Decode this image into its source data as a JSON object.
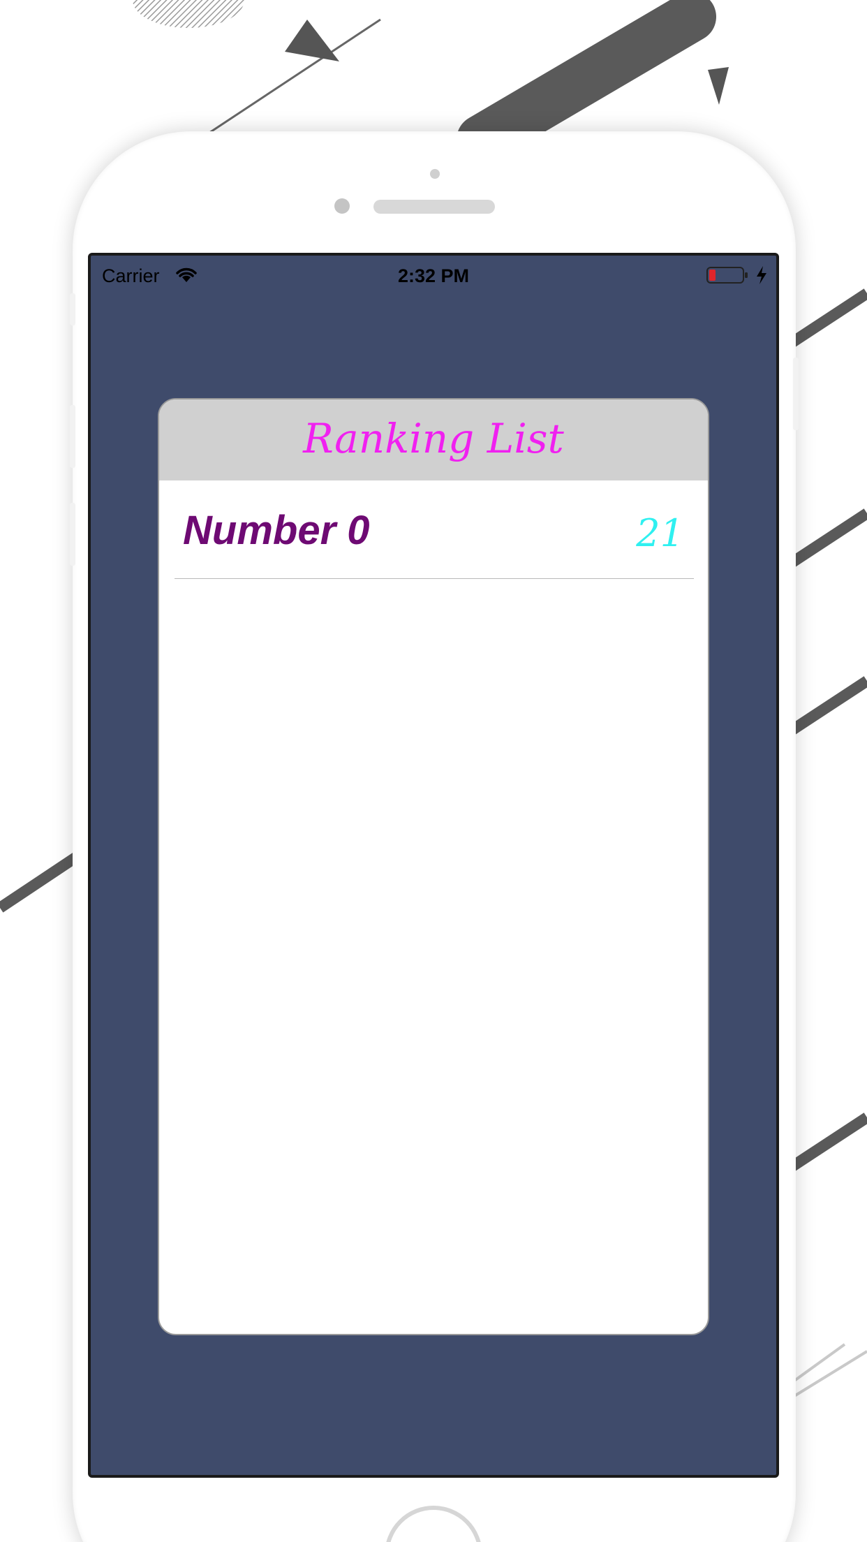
{
  "status_bar": {
    "carrier": "Carrier",
    "time": "2:32 PM",
    "icons": [
      "wifi-icon",
      "battery-icon",
      "charging-bolt-icon"
    ]
  },
  "ranking": {
    "title": "Ranking List",
    "rows": [
      {
        "name": "Number 0",
        "score": "21"
      }
    ]
  },
  "colors": {
    "screen_background": "#3f4b6b",
    "header_background": "#d0d0d0",
    "title": "#f020f0",
    "row_name": "#6e0a73",
    "row_score": "#2ff0f0",
    "battery_low": "#e0252b"
  }
}
